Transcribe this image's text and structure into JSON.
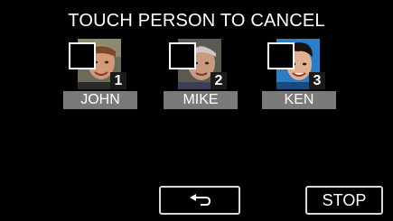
{
  "screen": {
    "title": "TOUCH PERSON TO CANCEL"
  },
  "persons": [
    {
      "number": "1",
      "name": "JOHN",
      "selected": false
    },
    {
      "number": "2",
      "name": "MIKE",
      "selected": false
    },
    {
      "number": "3",
      "name": "KEN",
      "selected": false
    }
  ],
  "buttons": {
    "back_icon": "return-arrow-icon",
    "stop_label": "STOP"
  },
  "colors": {
    "background": "#000000",
    "name_bar": "#7a7a7a",
    "button_border": "#d8d8d8"
  }
}
